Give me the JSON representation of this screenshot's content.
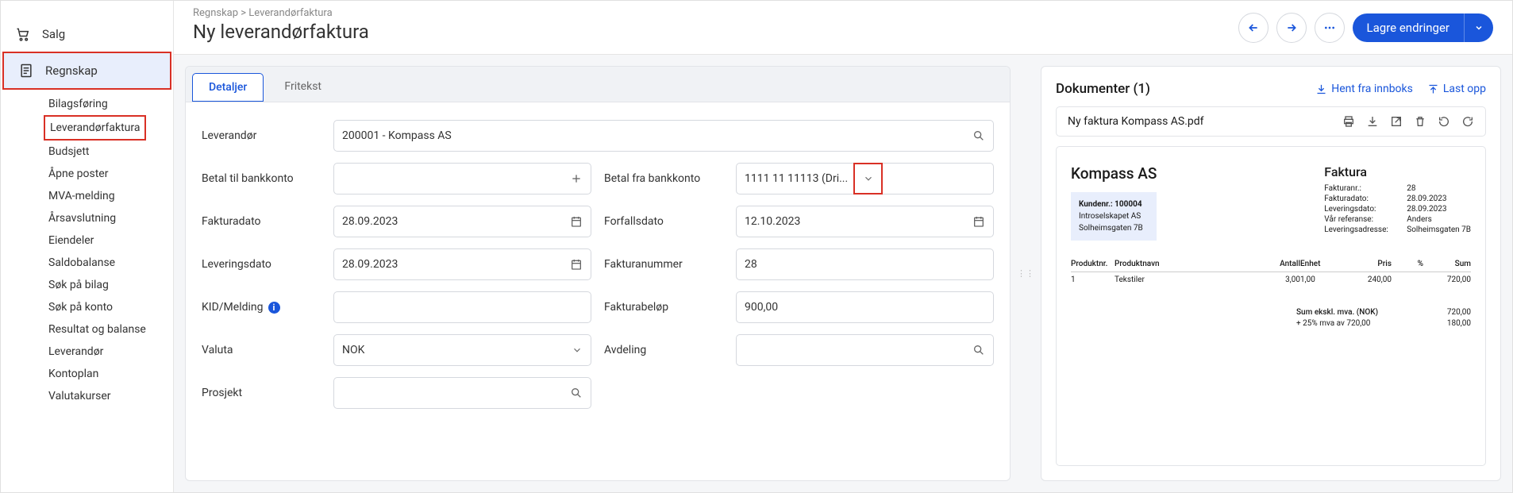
{
  "sidebar": {
    "items": [
      {
        "label": "Salg"
      },
      {
        "label": "Regnskap"
      }
    ],
    "sub_items": [
      {
        "label": "Bilagsføring"
      },
      {
        "label": "Leverandørfaktura"
      },
      {
        "label": "Budsjett"
      },
      {
        "label": "Åpne poster"
      },
      {
        "label": "MVA-melding"
      },
      {
        "label": "Årsavslutning"
      },
      {
        "label": "Eiendeler"
      },
      {
        "label": "Saldobalanse"
      },
      {
        "label": "Søk på bilag"
      },
      {
        "label": "Søk på konto"
      },
      {
        "label": "Resultat og balanse"
      },
      {
        "label": "Leverandør"
      },
      {
        "label": "Kontoplan"
      },
      {
        "label": "Valutakurser"
      }
    ]
  },
  "breadcrumb": "Regnskap > Leverandørfaktura",
  "page_title": "Ny leverandørfaktura",
  "primary_button": "Lagre endringer",
  "tabs": [
    {
      "label": "Detaljer"
    },
    {
      "label": "Fritekst"
    }
  ],
  "form": {
    "leverandor_label": "Leverandør",
    "leverandor_value": "200001 - Kompass AS",
    "betal_til_label": "Betal til bankkonto",
    "betal_til_value": "",
    "betal_fra_label": "Betal fra bankkonto",
    "betal_fra_value": "1111 11 11113 (Dri...",
    "fakturadato_label": "Fakturadato",
    "fakturadato_value": "28.09.2023",
    "forfallsdato_label": "Forfallsdato",
    "forfallsdato_value": "12.10.2023",
    "leveringsdato_label": "Leveringsdato",
    "leveringsdato_value": "28.09.2023",
    "fakturanummer_label": "Fakturanummer",
    "fakturanummer_value": "28",
    "kid_label": "KID/Melding",
    "kid_value": "",
    "fakturabelop_label": "Fakturabeløp",
    "fakturabelop_value": "900,00",
    "valuta_label": "Valuta",
    "valuta_value": "NOK",
    "avdeling_label": "Avdeling",
    "avdeling_value": "",
    "prosjekt_label": "Prosjekt",
    "prosjekt_value": ""
  },
  "documents": {
    "title": "Dokumenter (1)",
    "hent": "Hent fra innboks",
    "last_opp": "Last opp",
    "filename": "Ny faktura Kompass AS.pdf"
  },
  "invoice": {
    "company": "Kompass AS",
    "customer_no_label": "Kundenr.: 100004",
    "customer_name": "Introselskapet AS",
    "customer_addr": "Solheimsgaten 7B",
    "title": "Faktura",
    "meta": [
      {
        "k": "Fakturanr.:",
        "v": "28"
      },
      {
        "k": "Fakturadato:",
        "v": "28.09.2023"
      },
      {
        "k": "Leveringsdato:",
        "v": "28.09.2023"
      },
      {
        "k": "Vår referanse:",
        "v": "Anders"
      },
      {
        "k": "Leveringsadresse:",
        "v": "Solheimsgaten 7B"
      }
    ],
    "table_headers": [
      "Produktnr.",
      "Produktnavn",
      "Antall",
      "Enhet",
      "Pris",
      "%",
      "Sum"
    ],
    "table_rows": [
      {
        "nr": "1",
        "navn": "Tekstiler",
        "antall": "3,00",
        "enhet": "1,00",
        "pris": "240,00",
        "pct": "",
        "sum": "720,00"
      }
    ],
    "totals": [
      {
        "k": "Sum ekskl. mva. (NOK)",
        "v": "720,00"
      },
      {
        "k": "+ 25% mva av 720,00",
        "v": "180,00"
      }
    ]
  }
}
